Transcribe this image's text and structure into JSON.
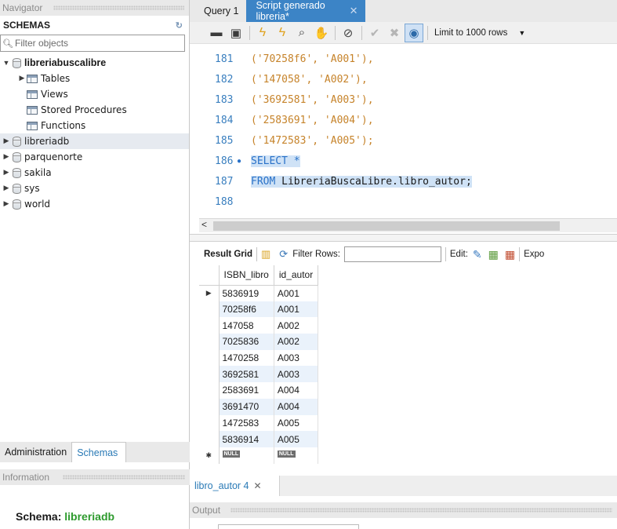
{
  "navigator": {
    "header": "Navigator",
    "schemas_title": "SCHEMAS",
    "filter_placeholder": "Filter objects",
    "tree": {
      "expanded_db": "libreriabuscalibre",
      "children": [
        "Tables",
        "Views",
        "Stored Procedures",
        "Functions"
      ],
      "other_dbs": [
        "libreriadb",
        "parquenorte",
        "sakila",
        "sys",
        "world"
      ],
      "selected_db": "libreriadb"
    },
    "bottom_tabs": [
      "Administration",
      "Schemas"
    ],
    "active_bottom_tab": "Schemas",
    "information_header": "Information",
    "schema_info": {
      "label": "Schema:",
      "value": "libreriadb"
    }
  },
  "editor": {
    "tabs": [
      {
        "label": "Query 1",
        "active": false
      },
      {
        "label": "Script generado libreria*",
        "active": true
      }
    ],
    "limit_label": "Limit to 1000 rows",
    "lines": [
      {
        "num": "181",
        "text": "('70258f6', 'A001'),",
        "kind": "values"
      },
      {
        "num": "182",
        "text": "('147058', 'A002'),",
        "kind": "values"
      },
      {
        "num": "183",
        "text": "('3692581', 'A003'),",
        "kind": "values"
      },
      {
        "num": "184",
        "text": "('2583691', 'A004'),",
        "kind": "values"
      },
      {
        "num": "185",
        "text": "('1472583', 'A005');",
        "kind": "values"
      },
      {
        "num": "186",
        "text": "SELECT *",
        "kind": "select"
      },
      {
        "num": "187",
        "text": "FROM LibreriaBuscaLibre.libro_autor;",
        "kind": "from"
      },
      {
        "num": "188",
        "text": "",
        "kind": "empty"
      }
    ]
  },
  "results": {
    "toolbar": {
      "result_grid": "Result Grid",
      "filter_rows": "Filter Rows:",
      "edit": "Edit:",
      "export": "Expo"
    },
    "columns": [
      "ISBN_libro",
      "id_autor"
    ],
    "rows": [
      [
        "5836919",
        "A001"
      ],
      [
        "70258f6",
        "A001"
      ],
      [
        "147058",
        "A002"
      ],
      [
        "7025836",
        "A002"
      ],
      [
        "1470258",
        "A003"
      ],
      [
        "3692581",
        "A003"
      ],
      [
        "2583691",
        "A004"
      ],
      [
        "3691470",
        "A004"
      ],
      [
        "1472583",
        "A005"
      ],
      [
        "5836914",
        "A005"
      ]
    ],
    "null_label": "NULL",
    "result_tab": "libro_autor 4",
    "output_header": "Output"
  }
}
